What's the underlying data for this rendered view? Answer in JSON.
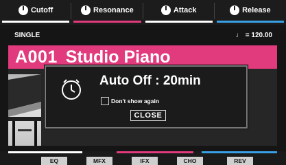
{
  "knobs": [
    {
      "label": "Cutoff",
      "color": "#ffffff"
    },
    {
      "label": "Resonance",
      "color": "#e13a7d"
    },
    {
      "label": "Attack",
      "color": "#ffffff"
    },
    {
      "label": "Release",
      "color": "#3aa0e6"
    }
  ],
  "mode": {
    "label": "SINGLE"
  },
  "tempo": {
    "symbol": "♩",
    "value": "= 120.00"
  },
  "patch": {
    "number": "A001",
    "name": "Studio Piano",
    "color": "#e13a7d"
  },
  "dialog": {
    "icon": "timer-icon",
    "title": "Auto Off : 20min",
    "checkbox_label": "Don't show again",
    "checkbox_checked": false,
    "close_label": "CLOSE"
  },
  "fx": {
    "buttons": [
      "EQ",
      "MFX",
      "IFX",
      "CHO",
      "REV"
    ],
    "segment_colors": [
      "#ffffff",
      "#e13a7d",
      "#3aa0e6"
    ]
  }
}
